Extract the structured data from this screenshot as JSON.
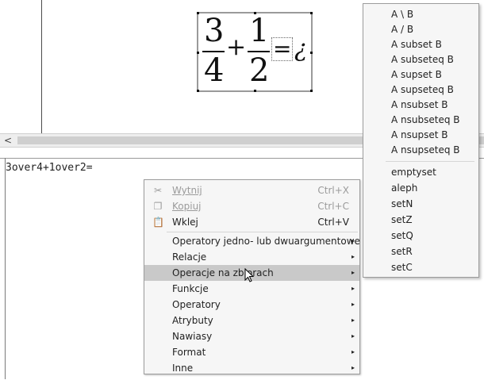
{
  "formula": {
    "num1": "3",
    "den1": "4",
    "plus": "+",
    "num2": "1",
    "den2": "2",
    "equals": "=",
    "placeholder": "¿"
  },
  "scrollbar": {
    "left_arrow": "<"
  },
  "editor": {
    "text": "3over4+1over2="
  },
  "context_menu": {
    "cut": {
      "label": "Wytnij",
      "shortcut": "Ctrl+X",
      "icon": "scissors-icon"
    },
    "copy": {
      "label": "Kopiuj",
      "shortcut": "Ctrl+C",
      "icon": "copy-icon"
    },
    "paste": {
      "label": "Wklej",
      "shortcut": "Ctrl+V",
      "icon": "paste-icon"
    },
    "items": [
      {
        "label": "Operatory jedno- lub dwuargumentowe"
      },
      {
        "label": "Relacje"
      },
      {
        "label": "Operacje na zbiorach"
      },
      {
        "label": "Funkcje"
      },
      {
        "label": "Operatory"
      },
      {
        "label": "Atrybuty"
      },
      {
        "label": "Nawiasy"
      },
      {
        "label": "Format"
      },
      {
        "label": "Inne"
      }
    ],
    "submenu_arrow": "▸"
  },
  "submenu": {
    "items": [
      "A \\ B",
      "A / B",
      "A subset B",
      "A subseteq B",
      "A supset B",
      "A supseteq B",
      "A nsubset B",
      "A nsubseteq B",
      "A nsupset B",
      "A nsupseteq B",
      "emptyset",
      "aleph",
      "setN",
      "setZ",
      "setQ",
      "setR",
      "setC"
    ]
  },
  "colors": {
    "highlight": "#c9c9c9",
    "menu_bg": "#f6f6f6",
    "disabled": "#9b9b9b"
  }
}
